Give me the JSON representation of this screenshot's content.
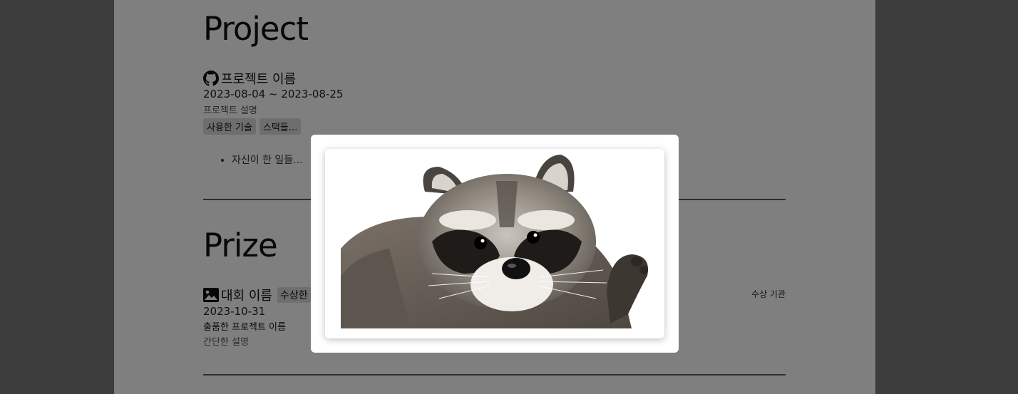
{
  "project": {
    "section_title": "Project",
    "name": "프로젝트 이름",
    "icon": "github-icon",
    "date": "2023-08-04 ~ 2023-08-25",
    "description": "프로젝트 설명",
    "tags": [
      "사용한 기술",
      "스택들..."
    ],
    "bullets": [
      "자신이 한 일들..."
    ]
  },
  "prize": {
    "section_title": "Prize",
    "name": "대회 이름",
    "icon": "image-icon",
    "award": "수상한",
    "organization": "수상 기관",
    "date": "2023-10-31",
    "submitted_project": "출품한 프로젝트 이름",
    "description": "간단한 설명"
  },
  "modal": {
    "image": "raccoon-photo",
    "overlay_color": "#000000"
  }
}
